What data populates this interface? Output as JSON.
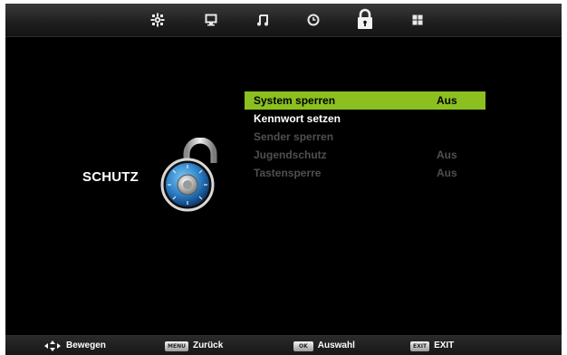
{
  "tabs": [
    {
      "name": "picture-settings-icon",
      "active": false
    },
    {
      "name": "pc-monitor-icon",
      "active": false
    },
    {
      "name": "music-note-icon",
      "active": false
    },
    {
      "name": "clock-icon",
      "active": false
    },
    {
      "name": "lock-icon",
      "active": true
    },
    {
      "name": "grid-icon",
      "active": false
    }
  ],
  "section": {
    "title": "SCHUTZ",
    "icon": "padlock-icon"
  },
  "menu": {
    "items": [
      {
        "label": "System sperren",
        "value": "Aus",
        "state": "selected"
      },
      {
        "label": "Kennwort setzen",
        "value": "",
        "state": "normal"
      },
      {
        "label": "Sender sperren",
        "value": "",
        "state": "disabled"
      },
      {
        "label": "Jugendschutz",
        "value": "Aus",
        "state": "disabled"
      },
      {
        "label": "Tastensperre",
        "value": "Aus",
        "state": "disabled"
      }
    ]
  },
  "hints": {
    "move": {
      "icon": "arrows-icon",
      "label": "Bewegen"
    },
    "back": {
      "key": "MENU",
      "label": "Zurück"
    },
    "select": {
      "key": "OK",
      "label": "Auswahl"
    },
    "exit": {
      "key": "EXIT",
      "label": "EXIT"
    }
  },
  "colors": {
    "selected_highlight": "#8bc020",
    "background": "#000000",
    "disabled_text": "#4f4f4f"
  }
}
